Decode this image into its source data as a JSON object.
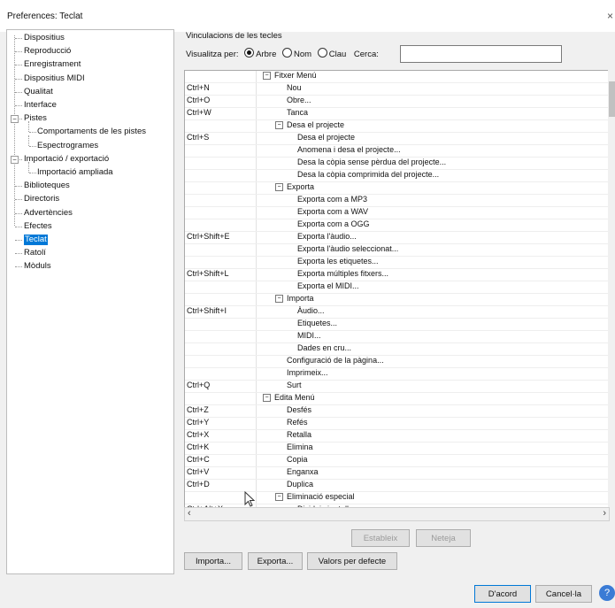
{
  "window": {
    "title": "Preferences: Teclat",
    "close_glyph": "×"
  },
  "sidebar": {
    "items": [
      {
        "label": "Dispositius"
      },
      {
        "label": "Reproducció"
      },
      {
        "label": "Enregistrament"
      },
      {
        "label": "Dispositius MIDI"
      },
      {
        "label": "Qualitat"
      },
      {
        "label": "Interface"
      },
      {
        "label": "Pistes",
        "children": [
          "Comportaments de les pistes",
          "Espectrogrames"
        ]
      },
      {
        "label": "Importació / exportació",
        "children": [
          "Importació ampliada"
        ]
      },
      {
        "label": "Biblioteques"
      },
      {
        "label": "Directoris"
      },
      {
        "label": "Advertències"
      },
      {
        "label": "Efectes"
      },
      {
        "label": "Teclat",
        "selected": true
      },
      {
        "label": "Ratolí"
      },
      {
        "label": "Mòduls"
      }
    ]
  },
  "panel": {
    "title": "Vinculacions de les tecles",
    "view_label": "Visualitza per:",
    "view_options": [
      "Arbre",
      "Nom",
      "Clau"
    ],
    "view_selected": "Arbre",
    "search_label": "Cerca:",
    "search_value": ""
  },
  "bindings": [
    {
      "g": "Fitxer Menú",
      "lvl": 0
    },
    {
      "k": "Ctrl+N",
      "c": "Nou",
      "lvl": 1
    },
    {
      "k": "Ctrl+O",
      "c": "Obre...",
      "lvl": 1
    },
    {
      "k": "Ctrl+W",
      "c": "Tanca",
      "lvl": 1
    },
    {
      "g": "Desa el projecte",
      "lvl": 1
    },
    {
      "k": "Ctrl+S",
      "c": "Desa el projecte",
      "lvl": 2
    },
    {
      "k": "",
      "c": "Anomena i desa el projecte...",
      "lvl": 2
    },
    {
      "k": "",
      "c": "Desa la còpia sense pèrdua del projecte...",
      "lvl": 2
    },
    {
      "k": "",
      "c": "Desa la còpia comprimida del projecte...",
      "lvl": 2
    },
    {
      "g": "Exporta",
      "lvl": 1
    },
    {
      "k": "",
      "c": "Exporta com a MP3",
      "lvl": 2
    },
    {
      "k": "",
      "c": "Exporta com a WAV",
      "lvl": 2
    },
    {
      "k": "",
      "c": "Exporta com a OGG",
      "lvl": 2
    },
    {
      "k": "Ctrl+Shift+E",
      "c": "Exporta l'àudio...",
      "lvl": 2
    },
    {
      "k": "",
      "c": "Exporta l'àudio seleccionat...",
      "lvl": 2
    },
    {
      "k": "",
      "c": "Exporta les etiquetes...",
      "lvl": 2
    },
    {
      "k": "Ctrl+Shift+L",
      "c": "Exporta múltiples fitxers...",
      "lvl": 2
    },
    {
      "k": "",
      "c": "Exporta el MIDI...",
      "lvl": 2
    },
    {
      "g": "Importa",
      "lvl": 1
    },
    {
      "k": "Ctrl+Shift+I",
      "c": "Àudio...",
      "lvl": 2
    },
    {
      "k": "",
      "c": "Etiquetes...",
      "lvl": 2
    },
    {
      "k": "",
      "c": "MIDI...",
      "lvl": 2
    },
    {
      "k": "",
      "c": "Dades en cru...",
      "lvl": 2
    },
    {
      "k": "",
      "c": "Configuració de la pàgina...",
      "lvl": 1
    },
    {
      "k": "",
      "c": "Imprimeix...",
      "lvl": 1
    },
    {
      "k": "Ctrl+Q",
      "c": "Surt",
      "lvl": 1
    },
    {
      "g": "Edita Menú",
      "lvl": 0
    },
    {
      "k": "Ctrl+Z",
      "c": "Desfés",
      "lvl": 1
    },
    {
      "k": "Ctrl+Y",
      "c": "Refés",
      "lvl": 1
    },
    {
      "k": "Ctrl+X",
      "c": "Retalla",
      "lvl": 1
    },
    {
      "k": "Ctrl+K",
      "c": "Elimina",
      "lvl": 1
    },
    {
      "k": "Ctrl+C",
      "c": "Copia",
      "lvl": 1
    },
    {
      "k": "Ctrl+V",
      "c": "Enganxa",
      "lvl": 1
    },
    {
      "k": "Ctrl+D",
      "c": "Duplica",
      "lvl": 1
    },
    {
      "g": "Eliminació especial",
      "lvl": 1
    },
    {
      "k": "Ctrl+Alt+X",
      "c": "Divideix i retalla",
      "lvl": 2
    }
  ],
  "buttons": {
    "set": "Estableix",
    "clear": "Neteja",
    "import": "Importa...",
    "export": "Exporta...",
    "defaults": "Valors per defecte",
    "ok": "D'acord",
    "cancel": "Cancel·la",
    "help_glyph": "?"
  },
  "icons": {
    "expand": "minus-box-icon",
    "help": "help-icon",
    "cursor": "mouse-pointer-icon"
  }
}
